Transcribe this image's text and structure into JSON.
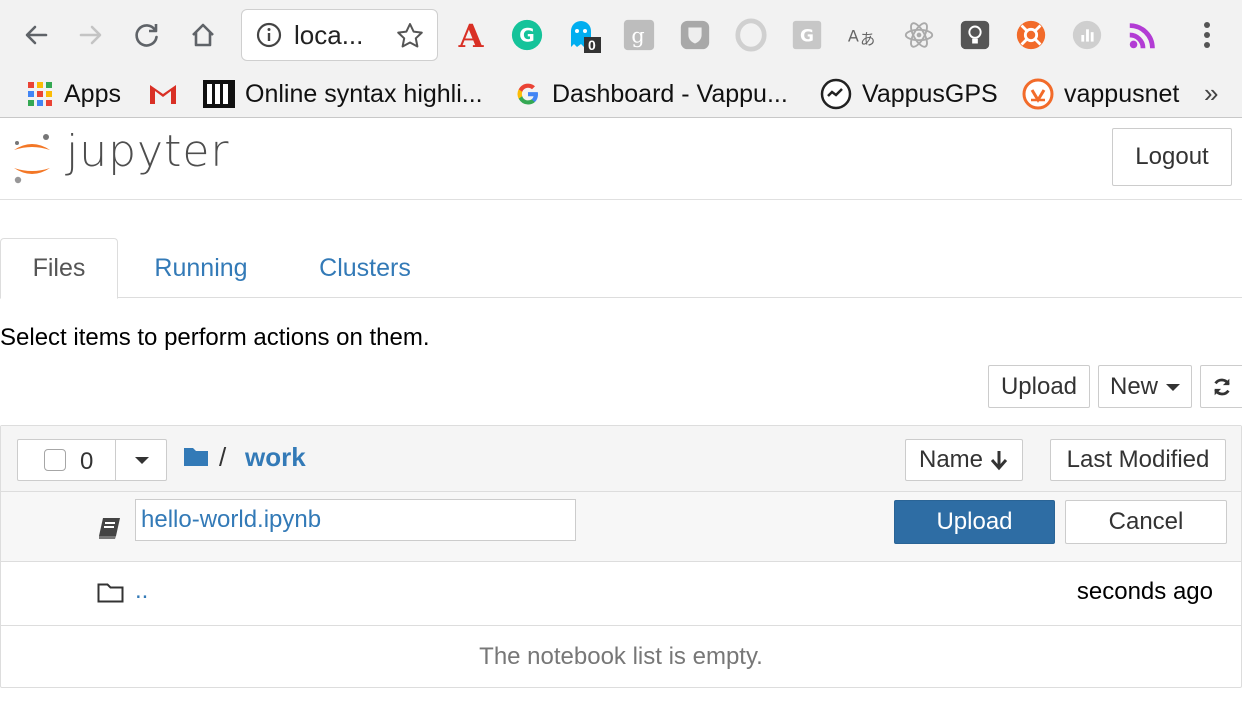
{
  "browser": {
    "url": "loca...",
    "extension_icons": [
      "acrobat-icon",
      "grammarly-icon",
      "ghostery-icon",
      "google-plus-icon",
      "shield-icon",
      "opera-icon",
      "google-docs-icon",
      "translate-icon",
      "react-devtools-icon",
      "lightbulb-icon",
      "lifebuoy-icon",
      "analytics-icon",
      "rss-icon"
    ],
    "ghostery_badge": "0"
  },
  "bookmarks": {
    "items": [
      {
        "label": "Apps",
        "icon": "apps-grid-icon"
      },
      {
        "label": "",
        "icon": "gmail-icon"
      },
      {
        "label": "Online syntax highli...",
        "icon": "syntax-highlighter-icon"
      },
      {
        "label": "Dashboard - Vappu...",
        "icon": "google-icon"
      },
      {
        "label": "VappusGPS",
        "icon": "gps-icon"
      },
      {
        "label": "vappusnet",
        "icon": "vappusnet-icon"
      }
    ],
    "more": "»"
  },
  "header": {
    "logo_text": "jupyter",
    "logout_label": "Logout"
  },
  "tabs": [
    {
      "label": "Files",
      "active": true
    },
    {
      "label": "Running",
      "active": false
    },
    {
      "label": "Clusters",
      "active": false
    }
  ],
  "toolbar": {
    "hint": "Select items to perform actions on them.",
    "upload_label": "Upload",
    "new_label": "New"
  },
  "list": {
    "selected_count": "0",
    "breadcrumb_sep": "/",
    "breadcrumb_dir": "work",
    "sort_name_label": "Name",
    "sort_modified_label": "Last Modified",
    "upload_row": {
      "filename": "hello-world.ipynb",
      "upload_label": "Upload",
      "cancel_label": "Cancel"
    },
    "parent_row": {
      "name": "..",
      "modified": "seconds ago"
    },
    "empty_message": "The notebook list is empty."
  },
  "colors": {
    "link": "#337ab7",
    "primary": "#2e6da4",
    "jupyter_orange": "#f37726"
  }
}
